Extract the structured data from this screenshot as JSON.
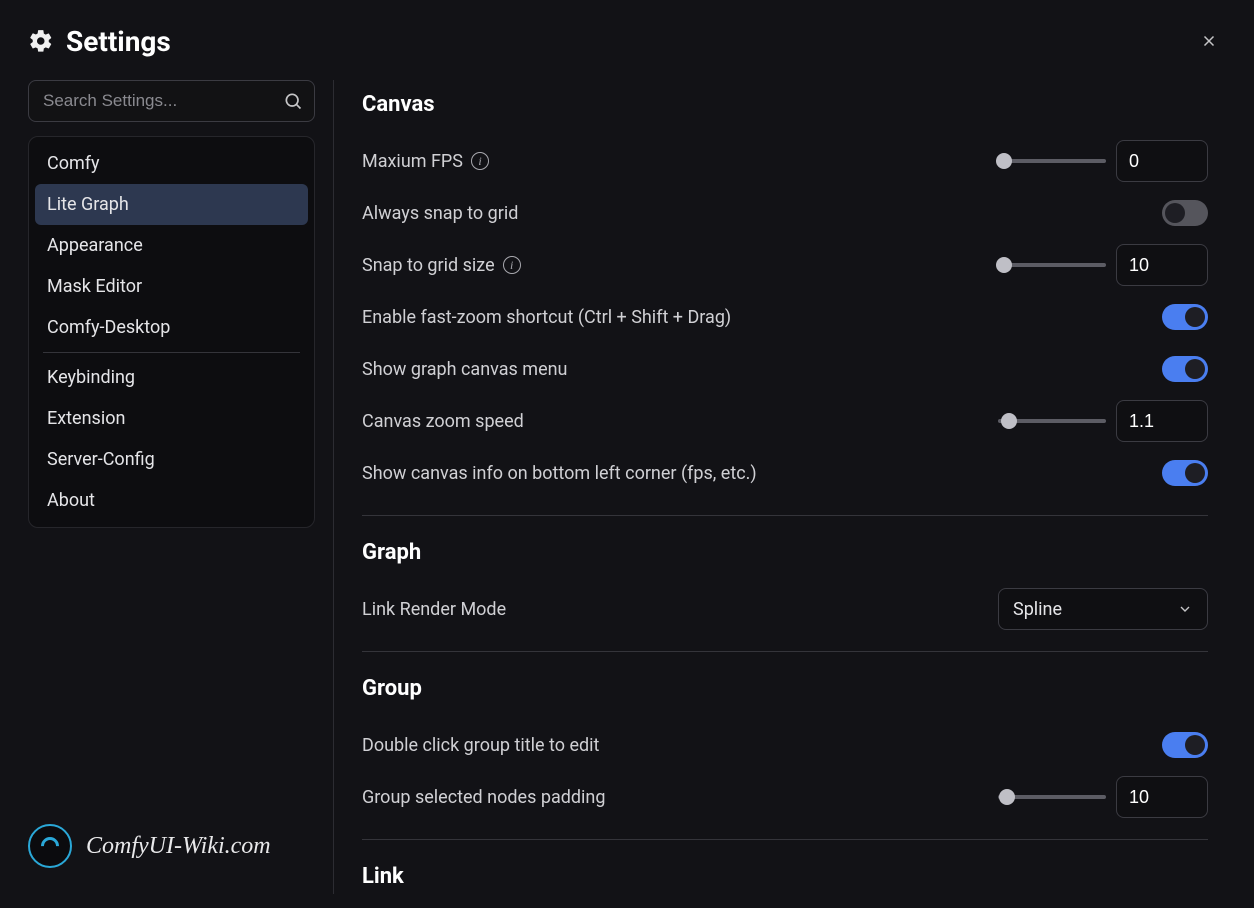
{
  "header": {
    "title": "Settings"
  },
  "search": {
    "placeholder": "Search Settings..."
  },
  "sidebar": {
    "items": [
      {
        "label": "Comfy",
        "active": false
      },
      {
        "label": "Lite Graph",
        "active": true
      },
      {
        "label": "Appearance",
        "active": false
      },
      {
        "label": "Mask Editor",
        "active": false
      },
      {
        "label": "Comfy-Desktop",
        "active": false
      }
    ],
    "items2": [
      {
        "label": "Keybinding"
      },
      {
        "label": "Extension"
      },
      {
        "label": "Server-Config"
      },
      {
        "label": "About"
      }
    ]
  },
  "sections": {
    "canvas": {
      "title": "Canvas",
      "max_fps_label": "Maxium FPS",
      "max_fps_value": "0",
      "always_snap_label": "Always snap to grid",
      "always_snap_on": false,
      "snap_size_label": "Snap to grid size",
      "snap_size_value": "10",
      "fast_zoom_label": "Enable fast-zoom shortcut (Ctrl + Shift + Drag)",
      "fast_zoom_on": true,
      "show_menu_label": "Show graph canvas menu",
      "show_menu_on": true,
      "zoom_speed_label": "Canvas zoom speed",
      "zoom_speed_value": "1.1",
      "show_info_label": "Show canvas info on bottom left corner (fps, etc.)",
      "show_info_on": true
    },
    "graph": {
      "title": "Graph",
      "link_render_label": "Link Render Mode",
      "link_render_value": "Spline"
    },
    "group": {
      "title": "Group",
      "dbl_click_label": "Double click group title to edit",
      "dbl_click_on": true,
      "padding_label": "Group selected nodes padding",
      "padding_value": "10"
    },
    "link": {
      "title": "Link"
    }
  },
  "watermark": "ComfyUI-Wiki.com"
}
